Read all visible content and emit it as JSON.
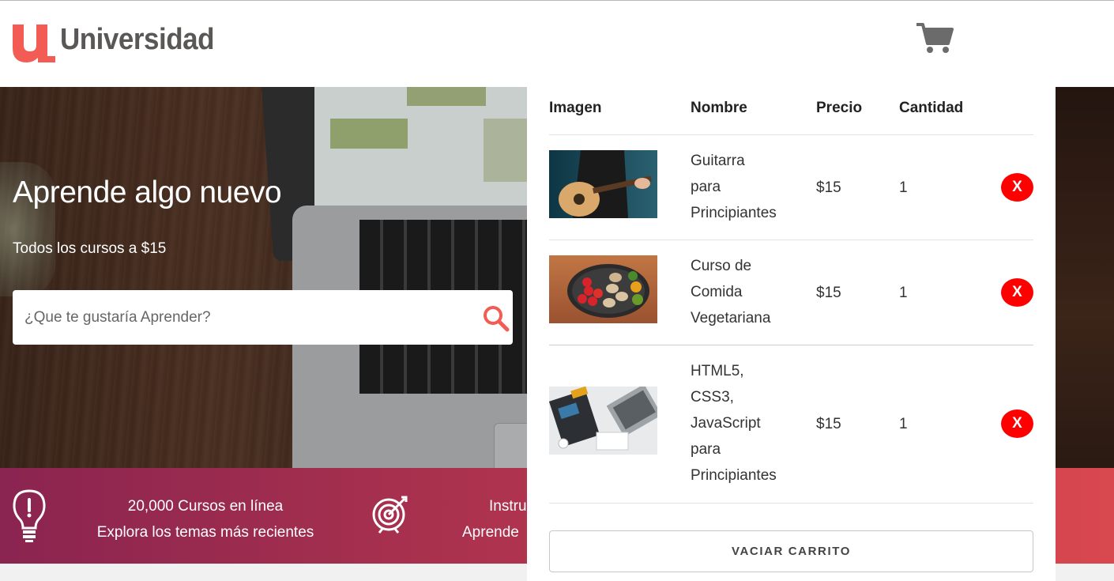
{
  "header": {
    "logo_text": "Universidad",
    "logo_mark": "u",
    "cart_icon": "shopping-cart-icon"
  },
  "hero": {
    "title": "Aprende algo nuevo",
    "subtitle": "Todos los cursos a $15",
    "search_placeholder": "¿Que te gustaría Aprender?",
    "search_icon": "search-icon"
  },
  "features": [
    {
      "icon": "lightbulb-icon",
      "line1": "20,000 Cursos en línea",
      "line2": "Explora los temas más recientes"
    },
    {
      "icon": "target-icon",
      "line1": "Instru",
      "line2": "Aprende"
    }
  ],
  "cart": {
    "headers": [
      "Imagen",
      "Nombre",
      "Precio",
      "Cantidad"
    ],
    "items": [
      {
        "name_lines": [
          "Guitarra",
          "para",
          "Principiantes"
        ],
        "price": "$15",
        "qty": "1",
        "remove": "X",
        "image": "guitar-thumbnail"
      },
      {
        "name_lines": [
          "Curso de",
          "Comida",
          "Vegetariana"
        ],
        "price": "$15",
        "qty": "1",
        "remove": "X",
        "image": "vegetables-thumbnail"
      },
      {
        "name_lines": [
          "HTML5,",
          "CSS3,",
          "JavaScript",
          "para",
          "Principiantes"
        ],
        "price": "$15",
        "qty": "1",
        "remove": "X",
        "image": "laptop-desk-thumbnail"
      }
    ],
    "empty_label": "VACIAR CARRITO"
  },
  "colors": {
    "brand_red": "#f25c54",
    "logo_gray": "#5a5856",
    "remove_red": "#ff0000",
    "bar_start": "#8a2450",
    "bar_end": "#d9484f"
  }
}
